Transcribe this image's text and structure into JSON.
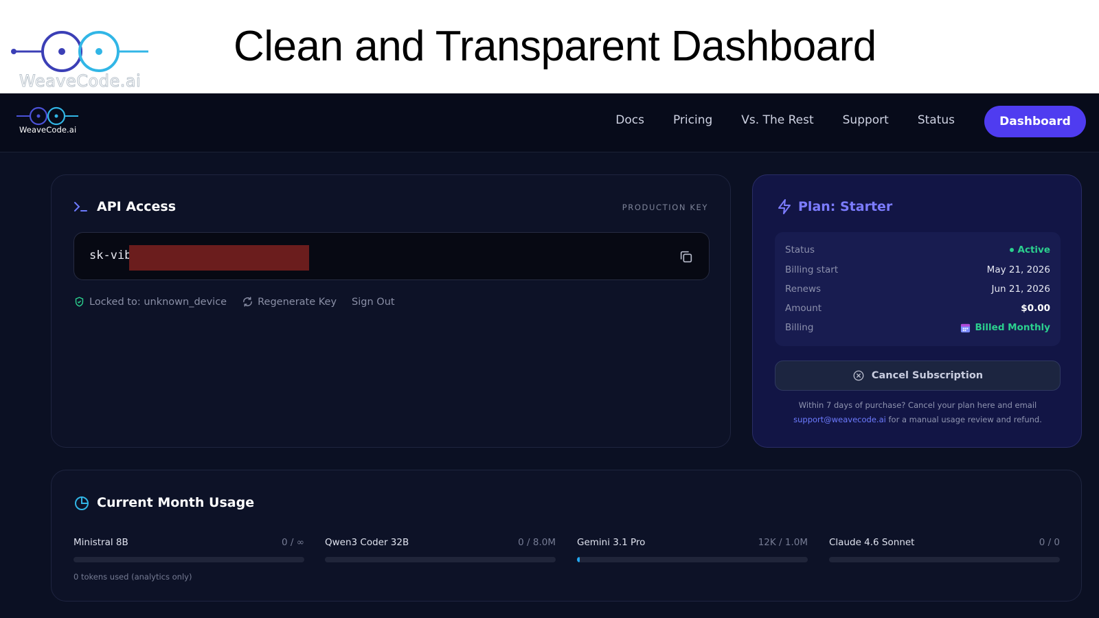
{
  "slide": {
    "title": "Clean and Transparent Dashboard",
    "logo_text": "WeaveCode.ai"
  },
  "nav": {
    "logo_text": "WeaveCode.ai",
    "links": [
      "Docs",
      "Pricing",
      "Vs. The Rest",
      "Support",
      "Status"
    ],
    "dashboard_label": "Dashboard"
  },
  "api": {
    "title": "API Access",
    "badge": "PRODUCTION KEY",
    "key_prefix": "sk-vib",
    "locked_label": "Locked to: unknown_device",
    "regenerate_label": "Regenerate Key",
    "signout_label": "Sign Out"
  },
  "plan": {
    "title": "Plan: Starter",
    "rows": [
      {
        "label": "Status",
        "value": "Active"
      },
      {
        "label": "Billing start",
        "value": "May 21, 2026"
      },
      {
        "label": "Renews",
        "value": "Jun 21, 2026"
      },
      {
        "label": "Amount",
        "value": "$0.00"
      },
      {
        "label": "Billing",
        "value": "Billed Monthly"
      }
    ],
    "cancel_label": "Cancel Subscription",
    "note_before": "Within 7 days of purchase? Cancel your plan here and email",
    "note_email": "support@weavecode.ai",
    "note_after": "for a manual usage review and refund."
  },
  "usage": {
    "title": "Current Month Usage",
    "models": [
      {
        "name": "Ministral 8B",
        "value": "0 / ∞",
        "fill_fraction": 0,
        "note": "0 tokens used (analytics only)"
      },
      {
        "name": "Qwen3 Coder 32B",
        "value": "0 / 8.0M",
        "fill_fraction": 0
      },
      {
        "name": "Gemini 3.1 Pro",
        "value": "12K / 1.0M",
        "fill_fraction": 0.012
      },
      {
        "name": "Claude 4.6 Sonnet",
        "value": "0 / 0",
        "fill_fraction": 0
      }
    ]
  },
  "colors": {
    "accent": "#4f3cf0",
    "active_green": "#2bd08e",
    "usage_bar": "#22a7f0",
    "background": "#0b1023"
  }
}
